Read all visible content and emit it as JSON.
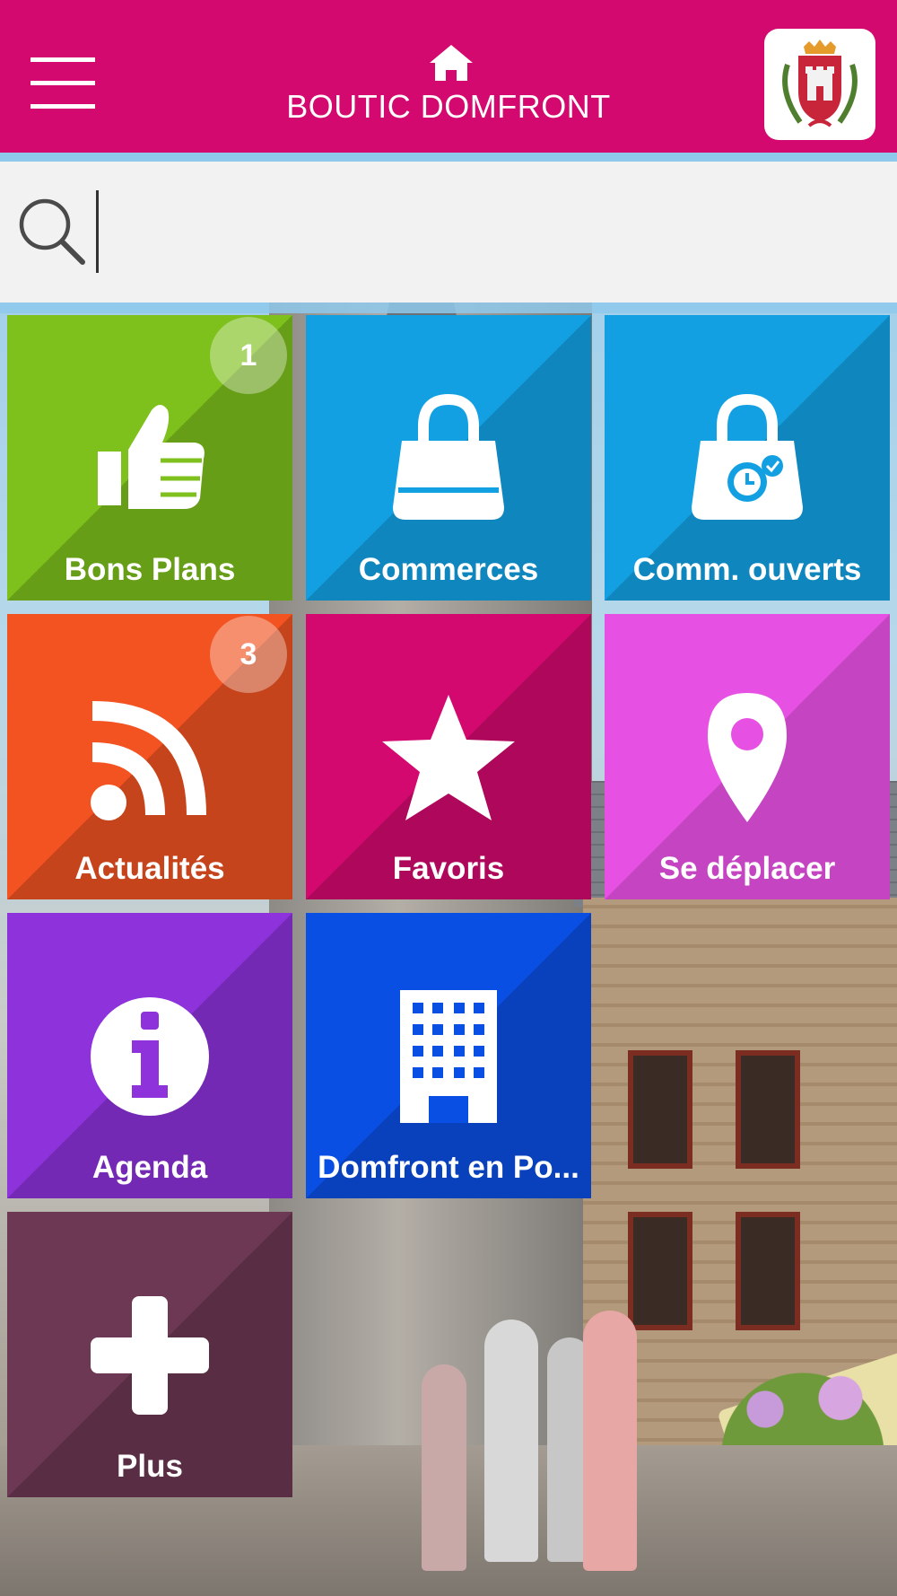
{
  "header": {
    "title": "BOUTIC DOMFRONT",
    "home_icon": "home-icon",
    "menu_icon": "hamburger-menu-icon",
    "logo": "domfront-coat-of-arms-logo"
  },
  "search": {
    "value": "",
    "placeholder": "",
    "icon": "search-icon"
  },
  "colors": {
    "header": "#d4096f",
    "search_bg": "#f2f2f2",
    "bons_plans": "#7ec11c",
    "commerces": "#13a0e2",
    "comm_ouverts": "#13a0e2",
    "actualites": "#f25321",
    "favoris": "#d4096f",
    "se_deplacer": "#e650e3",
    "agenda": "#8e32dc",
    "domfront": "#0a4fe4",
    "plus": "#6c3853"
  },
  "tiles": [
    {
      "label": "Bons Plans",
      "icon": "thumbs-up-icon",
      "badge": "1"
    },
    {
      "label": "Commerces",
      "icon": "shopping-bag-icon"
    },
    {
      "label": "Comm. ouverts",
      "icon": "shopping-bag-clock-icon"
    },
    {
      "label": "Actualités",
      "icon": "rss-feed-icon",
      "badge": "3"
    },
    {
      "label": "Favoris",
      "icon": "star-icon"
    },
    {
      "label": "Se déplacer",
      "icon": "location-pin-icon"
    },
    {
      "label": "Agenda",
      "icon": "info-icon"
    },
    {
      "label": "Domfront en Po...",
      "icon": "office-building-icon"
    },
    {
      "label": "Plus",
      "icon": "plus-icon"
    }
  ]
}
